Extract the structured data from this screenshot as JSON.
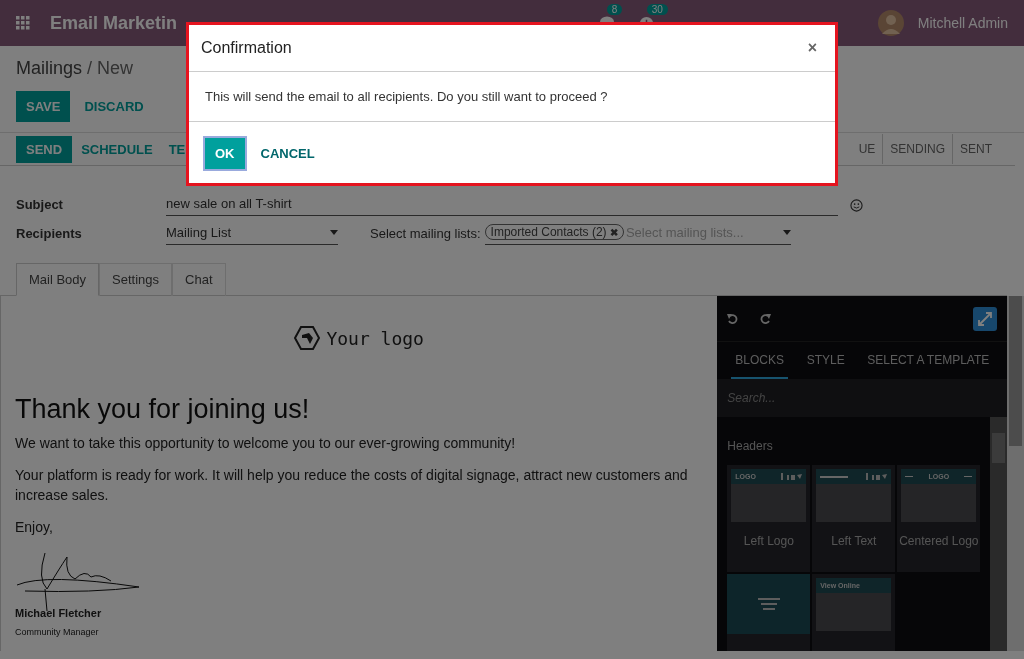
{
  "topbar": {
    "app": "Email Marketin",
    "badges": [
      {
        "count": "8"
      },
      {
        "count": "30"
      }
    ],
    "user": "Mitchell Admin"
  },
  "breadcrumb": {
    "parent": "Mailings",
    "separator": "/",
    "current": "New"
  },
  "actions": [
    {
      "label": "SAVE",
      "primary": true
    },
    {
      "label": "DISCARD",
      "primary": false
    }
  ],
  "statusbar": {
    "buttons": [
      {
        "label": "SEND",
        "primary": true
      },
      {
        "label": "SCHEDULE",
        "primary": false
      },
      {
        "label": "TE",
        "primary": false
      }
    ],
    "stages": [
      {
        "label": "UE",
        "selected": false
      },
      {
        "label": "SENDING",
        "selected": false
      },
      {
        "label": "SENT",
        "selected": false
      }
    ]
  },
  "form": {
    "subject_label": "Subject",
    "subject": "new sale on all T-shirt",
    "recipients_label": "Recipients",
    "recipients": "Mailing List",
    "lists_label": "Select mailing lists:",
    "tags": [
      {
        "label": "Imported Contacts (2)",
        "remove": "✖"
      }
    ],
    "lists_placeholder": "Select mailing lists..."
  },
  "tabs": [
    {
      "label": "Mail Body",
      "selected": true
    },
    {
      "label": "Settings",
      "selected": false
    },
    {
      "label": "Chat",
      "selected": false
    }
  ],
  "email": {
    "logo": "Your logo",
    "heading": "Thank you for joining us!",
    "paragraphs": [
      "We want to take this opportunity to welcome you to our ever-growing community!",
      "Your platform is ready for work. It will help you reduce the costs of digital signage, attract new customers and increase sales.",
      "Enjoy,"
    ],
    "signer": "Michael Fletcher",
    "role": "Community Manager"
  },
  "editor": {
    "tabs": [
      {
        "label": "BLOCKS",
        "selected": true
      },
      {
        "label": "STYLE",
        "selected": false
      },
      {
        "label": "SELECT A TEMPLATE",
        "selected": false
      }
    ],
    "search_placeholder": "Search...",
    "section": "Headers",
    "blocks": [
      {
        "kind": "left-logo",
        "label": "Left Logo",
        "thumb_text": "LOGO"
      },
      {
        "kind": "left-text",
        "label": "Left Text"
      },
      {
        "kind": "centered-logo",
        "label": "Centered Logo",
        "thumb_text": "LOGO"
      },
      {
        "kind": "cover"
      },
      {
        "kind": "view-online",
        "thumb_text": "View Online"
      }
    ]
  },
  "modal": {
    "title": "Confirmation",
    "close": "×",
    "message": "This will send the email to all recipients. Do you still want to proceed ?",
    "ok": "OK",
    "cancel": "CANCEL"
  }
}
